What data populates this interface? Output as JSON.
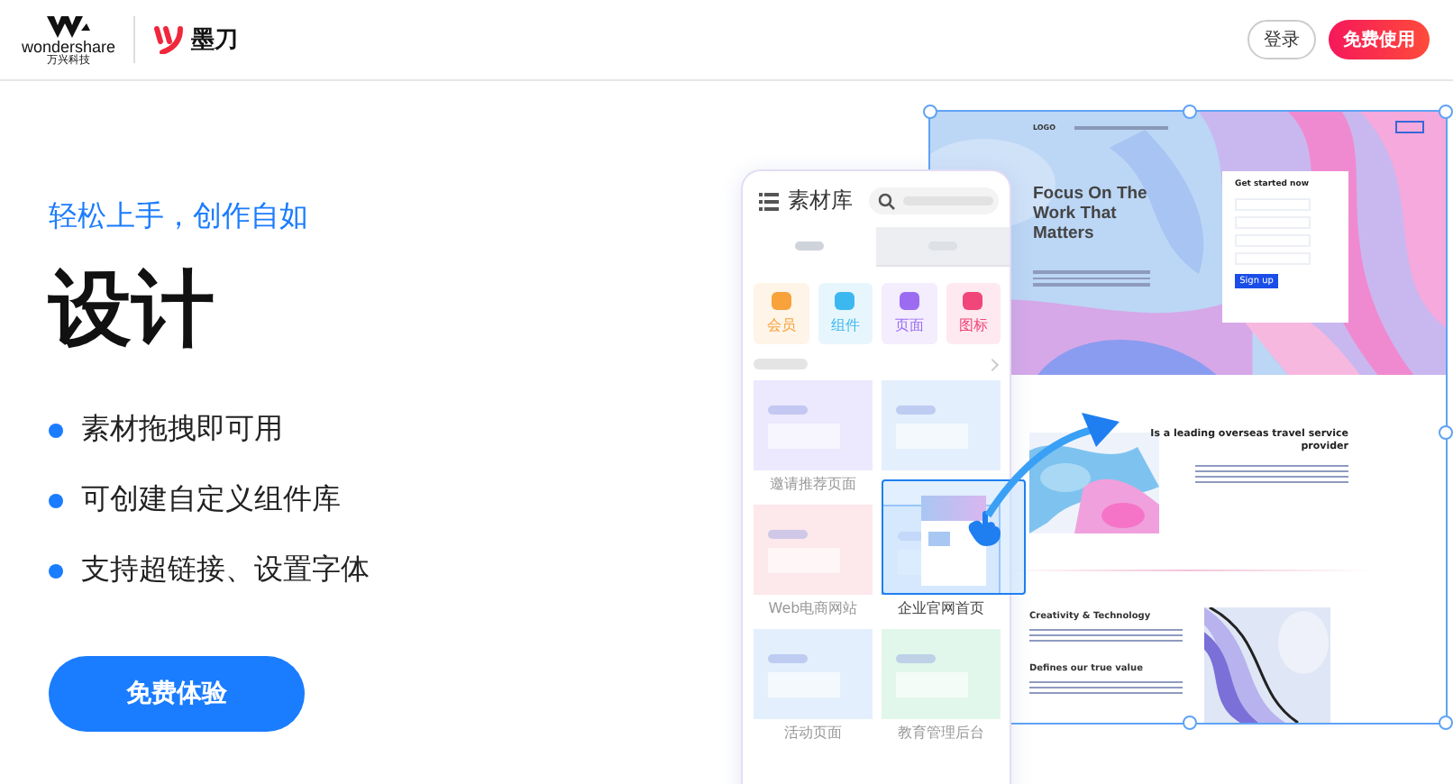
{
  "header": {
    "brand": "wondershare",
    "brand_sub": "万兴科技",
    "product": "墨刀",
    "buttons": [
      {
        "label": "登录",
        "kind": "outline"
      },
      {
        "label": "免费使用",
        "kind": "primary"
      }
    ]
  },
  "hero": {
    "tagline": "轻松上手，创作自如",
    "title": "设计",
    "features": [
      "素材拖拽即可用",
      "可创建自定义组件库",
      "支持超链接、设置字体"
    ],
    "cta": "免费体验"
  },
  "library": {
    "title": "素材库",
    "tabs": [
      {
        "selected": true
      },
      {
        "selected": false
      }
    ],
    "categories": [
      {
        "label": "会员",
        "color": "#f7a23b"
      },
      {
        "label": "组件",
        "color": "#3cb8f0"
      },
      {
        "label": "页面",
        "color": "#9b6cf2"
      },
      {
        "label": "图标",
        "color": "#f0467a"
      }
    ],
    "templates": [
      {
        "label": "邀请推荐页面",
        "color": "#ece8fd",
        "selected": false
      },
      {
        "color": "#e4effd",
        "selected": false
      },
      {
        "label": "Web电商网站",
        "color": "#fde8ec",
        "selected": false
      },
      {
        "label": "企业官网首页",
        "color": "#e4effd",
        "selected": true
      },
      {
        "label": "活动页面",
        "color": "#e4effd",
        "selected": false
      },
      {
        "label": "教育管理后台",
        "color": "#e2f7ec",
        "selected": false
      }
    ]
  },
  "preview": {
    "logo": "LOGO",
    "headline": "Focus On The Work That Matters",
    "form_title": "Get started now",
    "form_button": "Sign up",
    "section_title": "Is a leading overseas travel service provider",
    "blocks": [
      "Creativity & Technology",
      "Defines our true value"
    ]
  }
}
